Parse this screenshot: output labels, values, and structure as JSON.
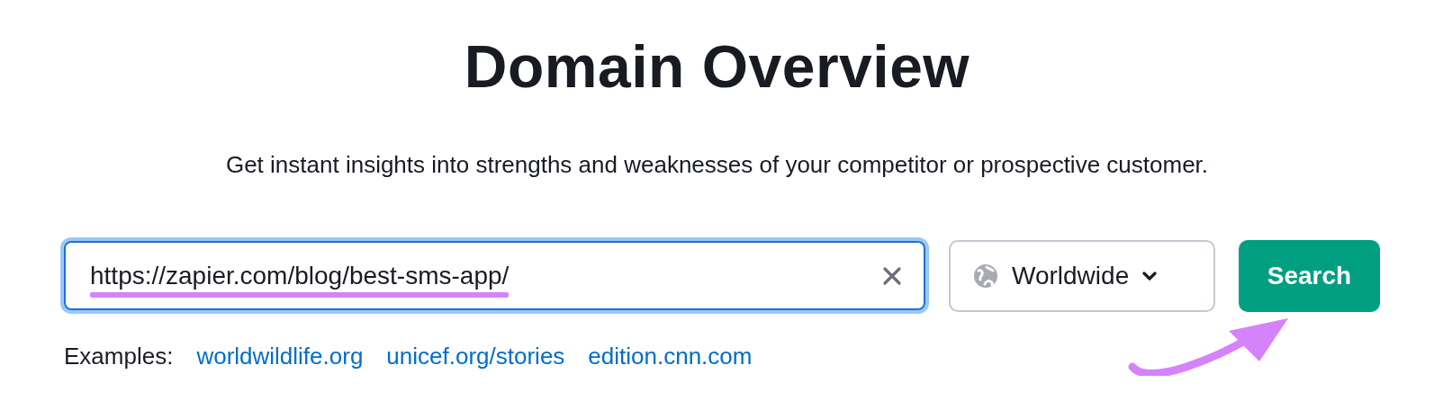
{
  "title": "Domain Overview",
  "subtitle": "Get instant insights into strengths and weaknesses of your competitor or prospective customer.",
  "search_field": {
    "value": "https://zapier.com/blog/best-sms-app/"
  },
  "region_dropdown": {
    "label": "Worldwide"
  },
  "search_button": {
    "label": "Search"
  },
  "examples": {
    "label": "Examples:",
    "links": [
      "worldwildlife.org",
      "unicef.org/stories",
      "edition.cnn.com"
    ]
  }
}
